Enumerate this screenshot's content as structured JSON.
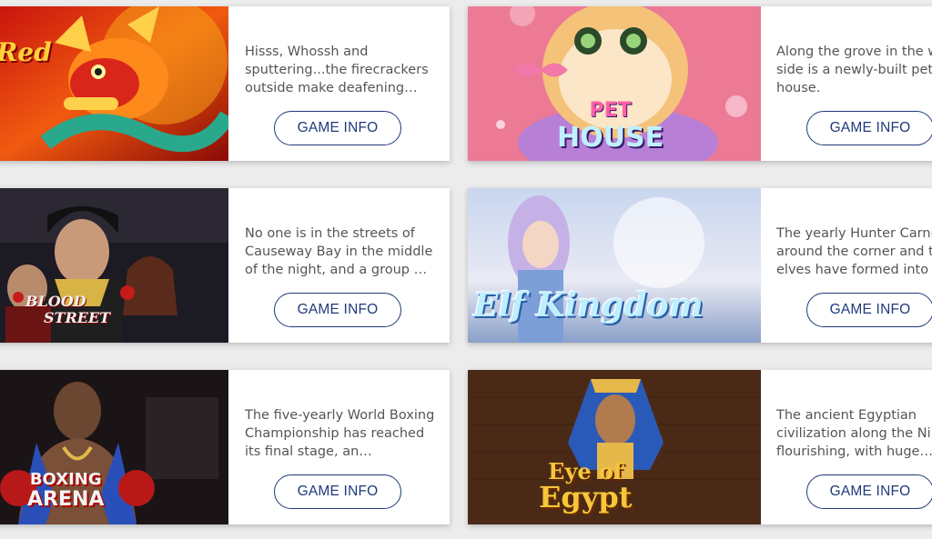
{
  "games": [
    {
      "title": "Red",
      "description": "Hisss, Whossh and sputtering...the firecrackers outside make deafening…",
      "button": "GAME INFO"
    },
    {
      "title": "PET HOUSE",
      "title_line1": "PET",
      "title_line2": "HOUSE",
      "description": "Along the grove in the w side is a newly-built pet house.",
      "button": "GAME INFO"
    },
    {
      "title": "BLOOD STREET",
      "title_line1": "BLOOD",
      "title_line2": "STREET",
      "description": "No one is in the streets of Causeway Bay in the middle of the night, and a group …",
      "button": "GAME INFO"
    },
    {
      "title": "Elf Kingdom",
      "description": "The yearly Hunter Carni around the corner and t elves have formed into t",
      "button": "GAME INFO"
    },
    {
      "title": "BOXING ARENA",
      "title_line1": "BOXING",
      "title_line2": "ARENA",
      "description": "The five-yearly World Boxing Championship has reached its final stage, an…",
      "button": "GAME INFO"
    },
    {
      "title": "Eye of Egypt",
      "title_line1": "Eye of",
      "title_line2": "Egypt",
      "description": "The ancient Egyptian civilization along the Ni flourishing, with huge…",
      "button": "GAME INFO"
    }
  ]
}
